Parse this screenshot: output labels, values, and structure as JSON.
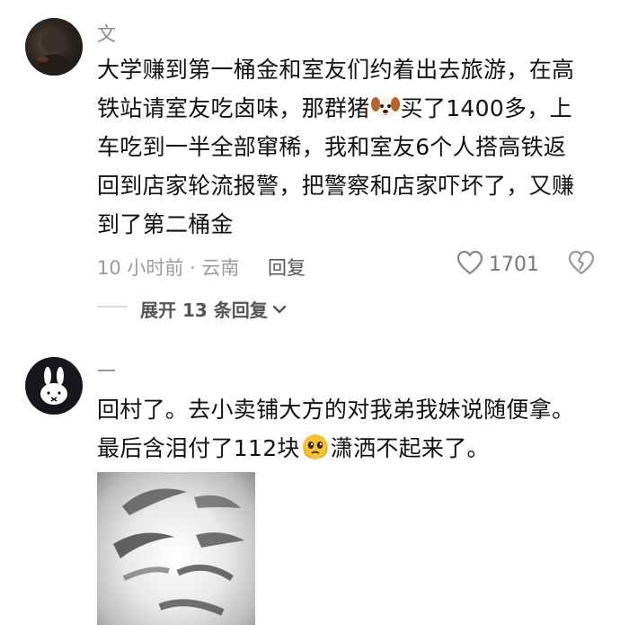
{
  "comments": [
    {
      "username": "文",
      "text_parts": [
        "大学赚到第一桶金和室友们约着出去旅游，在高",
        "铁站请室友吃卤味，那群猪",
        "买了1400多，上",
        "车吃到一半全部窜稀，我和室友6个人搭高铁返",
        "回到店家轮流报警，把警察和店家吓坏了，又赚",
        "到了第二桶金"
      ],
      "emoji": "dog-face-emoji",
      "time_location": "10 小时前 · 云南",
      "reply_label": "回复",
      "like_count": "1701",
      "expand_label": "展开 13 条回复"
    },
    {
      "username": "一",
      "text_parts": [
        "回村了。去小卖铺大方的对我弟我妹说随便拿。",
        "最后含泪付了112块",
        "潇洒不起来了。"
      ],
      "emoji": "pleading-face-emoji"
    }
  ],
  "colors": {
    "meta_gray": "#9b9b9b",
    "text": "#111111",
    "dislike_icon": "#999999"
  }
}
